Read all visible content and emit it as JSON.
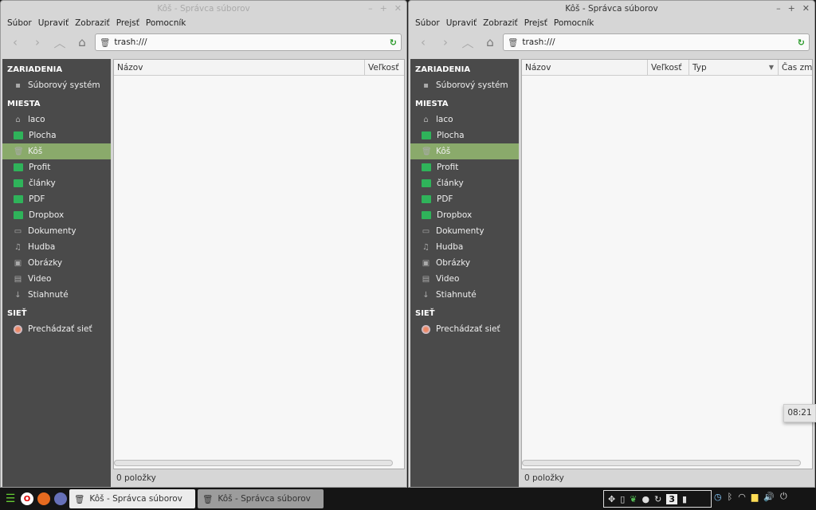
{
  "windows": [
    {
      "title": "Kôš - Správca súborov",
      "active": false,
      "menu": [
        "Súbor",
        "Upraviť",
        "Zobraziť",
        "Prejsť",
        "Pomocník"
      ],
      "location": "trash:///",
      "columns": [
        {
          "label": "Názov"
        },
        {
          "label": "Veľkosť"
        }
      ],
      "status": "0 položky"
    },
    {
      "title": "Kôš - Správca súborov",
      "active": true,
      "menu": [
        "Súbor",
        "Upraviť",
        "Zobraziť",
        "Prejsť",
        "Pomocník"
      ],
      "location": "trash:///",
      "columns": [
        {
          "label": "Názov"
        },
        {
          "label": "Veľkosť"
        },
        {
          "label": "Typ",
          "sorted": "descending"
        },
        {
          "label": "Čas zmeny"
        }
      ],
      "status": "0 položky"
    }
  ],
  "sidebar": {
    "sections": [
      {
        "label": "ZARIADENIA",
        "items": [
          {
            "label": "Súborový systém",
            "icon": "drive-icon"
          }
        ]
      },
      {
        "label": "MIESTA",
        "items": [
          {
            "label": "laco",
            "icon": "home-icon"
          },
          {
            "label": "Plocha",
            "icon": "folder-icon"
          },
          {
            "label": "Kôš",
            "icon": "trash-icon",
            "selected": true
          },
          {
            "label": "Profit",
            "icon": "folder-icon"
          },
          {
            "label": "články",
            "icon": "folder-icon"
          },
          {
            "label": "PDF",
            "icon": "folder-icon"
          },
          {
            "label": "Dropbox",
            "icon": "folder-icon"
          },
          {
            "label": "Dokumenty",
            "icon": "documents-icon"
          },
          {
            "label": "Hudba",
            "icon": "music-icon"
          },
          {
            "label": "Obrázky",
            "icon": "pictures-icon"
          },
          {
            "label": "Video",
            "icon": "video-icon"
          },
          {
            "label": "Stiahnuté",
            "icon": "download-icon"
          }
        ]
      },
      {
        "label": "SIEŤ",
        "items": [
          {
            "label": "Prechádzať sieť",
            "icon": "network-icon"
          }
        ]
      }
    ]
  },
  "taskbar": {
    "tasks": [
      {
        "label": "Kôš - Správca súborov"
      },
      {
        "label": "Kôš - Správca súborov"
      }
    ],
    "workspace": "3",
    "clock_tooltip": "08:21"
  },
  "colors": {
    "selection": "#8aaa6b",
    "folder": "#2fb35a",
    "sidebar": "#4a4a4a"
  }
}
